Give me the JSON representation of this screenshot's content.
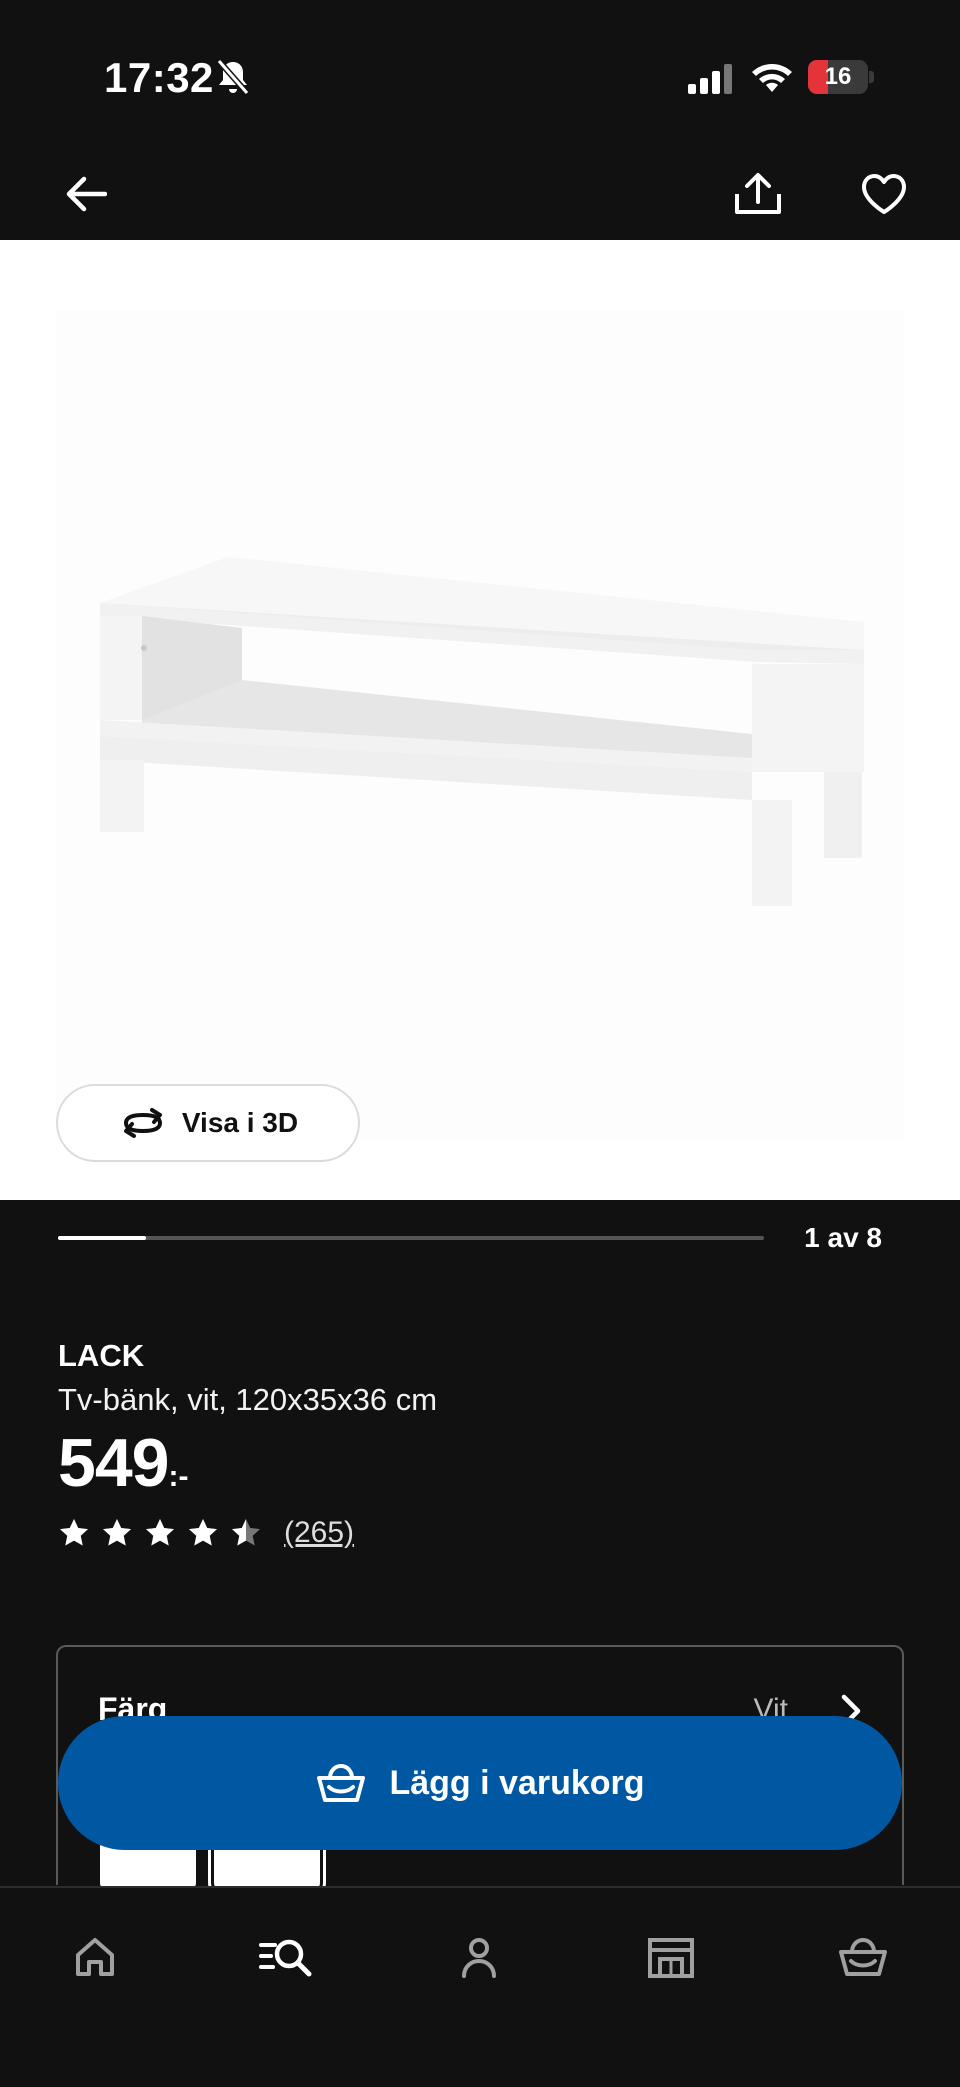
{
  "status_bar": {
    "time": "17:32",
    "battery_level": "16",
    "icons": [
      "bell-slash-icon",
      "signal-icon",
      "wifi-icon",
      "battery-icon"
    ]
  },
  "top_bar": {
    "icons": [
      "back-arrow-icon",
      "share-icon",
      "heart-icon"
    ]
  },
  "gallery": {
    "view_3d_label": "Visa i 3D",
    "counter": "1 av 8",
    "progress_fraction": 0.125
  },
  "product": {
    "name": "LACK",
    "description": "Tv-bänk, vit, 120x35x36 cm",
    "price": "549",
    "price_suffix": ":-",
    "rating": 4.5,
    "rating_max": 5,
    "review_count": "(265)"
  },
  "color_selector": {
    "label": "Färg",
    "value": "Vit"
  },
  "cta": {
    "label": "Lägg i varukorg",
    "color": "#0058a3"
  },
  "bottom_nav": {
    "items": [
      "home-icon",
      "search-icon",
      "profile-icon",
      "store-icon",
      "cart-icon"
    ]
  }
}
